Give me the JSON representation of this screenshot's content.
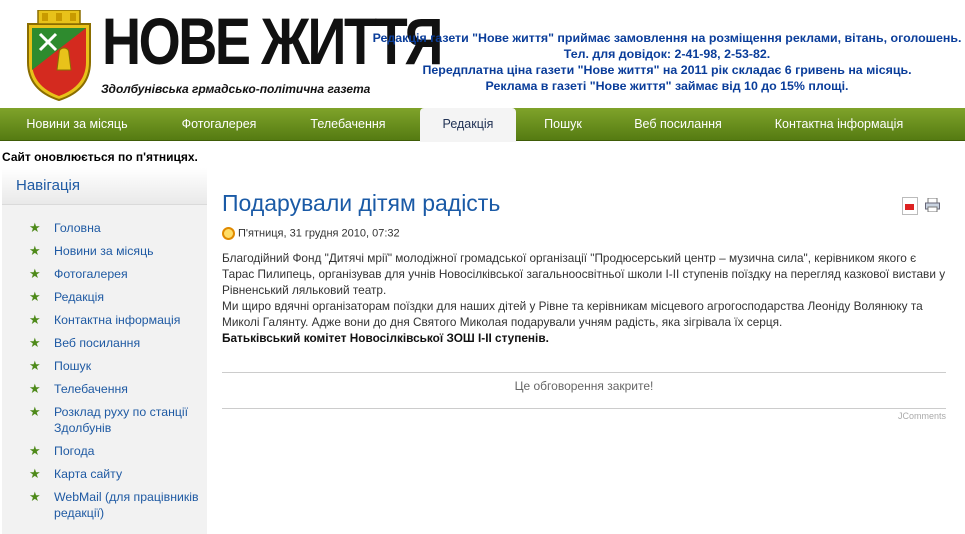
{
  "header": {
    "title": "НОВЕ ЖИТТЯ",
    "subtitle": "Здолбунівська грмадсько-політична газета",
    "info": [
      "Редакція газети \"Нове життя\" приймає замовлення на розміщення реклами, вітань, оголошень.",
      "Тел. для довідок: 2-41-98, 2-53-82.",
      "Передплатна ціна газети \"Нове життя\" на 2011 рік складає 6 гривень на місяць.",
      "Реклама в газеті \"Нове життя\" займає від 10 до 15% площі."
    ]
  },
  "nav": {
    "items": [
      {
        "label": "Новини за місяць"
      },
      {
        "label": "Фотогалерея"
      },
      {
        "label": "Телебачення"
      },
      {
        "label": "Редакція"
      },
      {
        "label": "Пошук"
      },
      {
        "label": "Веб посилання"
      },
      {
        "label": "Контактна інформація"
      }
    ],
    "active": "Редакція"
  },
  "notice": "Сайт оновлюється по п'ятницях.",
  "sidebar": {
    "title": "Навігація",
    "items": [
      {
        "label": "Головна"
      },
      {
        "label": "Новини за місяць"
      },
      {
        "label": "Фотогалерея"
      },
      {
        "label": "Редакція"
      },
      {
        "label": "Контактна інформація"
      },
      {
        "label": "Веб посилання"
      },
      {
        "label": "Пошук"
      },
      {
        "label": "Телебачення"
      },
      {
        "label": "Розклад руху по станції Здолбунів"
      },
      {
        "label": "Погода"
      },
      {
        "label": "Карта сайту"
      },
      {
        "label": "WebMail (для працівників редакції)"
      }
    ]
  },
  "article": {
    "title": "Подарували дітям радість",
    "date": "П'ятниця, 31 грудня 2010, 07:32",
    "paragraph1": "Благодійний Фонд \"Дитячі мрії\" молодіжної громадської організації \"Продюсерський центр – музична сила\", керівником якого є Тарас Пилипець, організував для учнів Новосілківської загальноосвітньої школи І-ІІ ступенів поїздку на перегляд казкової вистави у Рівненський ляльковий театр.",
    "paragraph2": "Ми щиро вдячні організаторам поїздки для наших дітей у Рівне та керівникам місцевого агрогосподарства Леоніду Волянюку та Миколі Галянту. Адже вони до дня Святого Миколая подарували учням радість, яка зігрівала їх серця.",
    "signature": "Батьківський комітет Новосілківської ЗОШ І-ІІ ступенів."
  },
  "comments": {
    "closed_text": "Це обговорення закрите!",
    "powered": "JComments"
  },
  "colors": {
    "nav_green": "#6a9020",
    "link_blue": "#1f5aa3",
    "header_info_blue": "#0a3d9a"
  }
}
